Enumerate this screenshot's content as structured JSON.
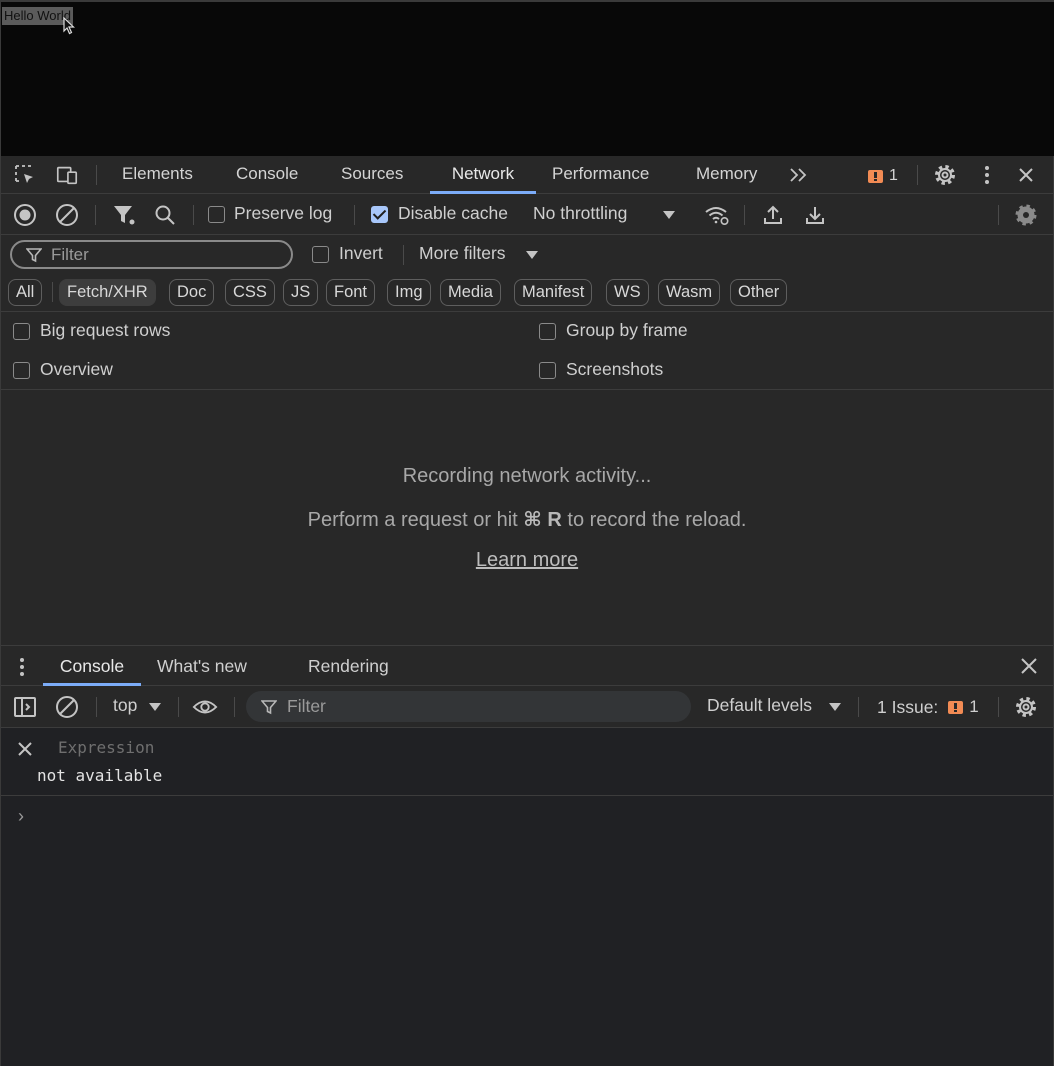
{
  "page": {
    "hello_text": "Hello World"
  },
  "main_tabs": [
    {
      "label": "Elements"
    },
    {
      "label": "Console"
    },
    {
      "label": "Sources"
    },
    {
      "label": "Network",
      "active": true
    },
    {
      "label": "Performance"
    },
    {
      "label": "Memory"
    }
  ],
  "issues_badge_count": "1",
  "network": {
    "preserve_log_label": "Preserve log",
    "preserve_log_checked": false,
    "disable_cache_label": "Disable cache",
    "disable_cache_checked": true,
    "throttling_value": "No throttling",
    "filter_placeholder": "Filter",
    "invert_label": "Invert",
    "more_filters_label": "More filters",
    "type_filters": [
      "All",
      "Fetch/XHR",
      "Doc",
      "CSS",
      "JS",
      "Font",
      "Img",
      "Media",
      "Manifest",
      "WS",
      "Wasm",
      "Other"
    ],
    "selected_type_filter": "Fetch/XHR",
    "options": {
      "big_request_rows": "Big request rows",
      "group_by_frame": "Group by frame",
      "overview": "Overview",
      "screenshots": "Screenshots"
    },
    "empty_state": {
      "line1": "Recording network activity...",
      "line2_prefix": "Perform a request or hit",
      "line2_shortcut": "⌘ R",
      "line2_suffix": "to record the reload.",
      "learn_more": "Learn more"
    }
  },
  "drawer": {
    "tabs": [
      {
        "label": "Console",
        "active": true
      },
      {
        "label": "What's new"
      },
      {
        "label": "Rendering"
      }
    ],
    "context": "top",
    "filter_placeholder": "Filter",
    "levels": "Default levels",
    "issues_label": "1 Issue:",
    "issues_count": "1",
    "expression_placeholder": "Expression",
    "expression_value": "not available",
    "prompt": "›"
  },
  "colors": {
    "accent": "#7cacf8",
    "issue_badge": "#f28b54",
    "checkbox_checked": "#a8c7fa"
  }
}
